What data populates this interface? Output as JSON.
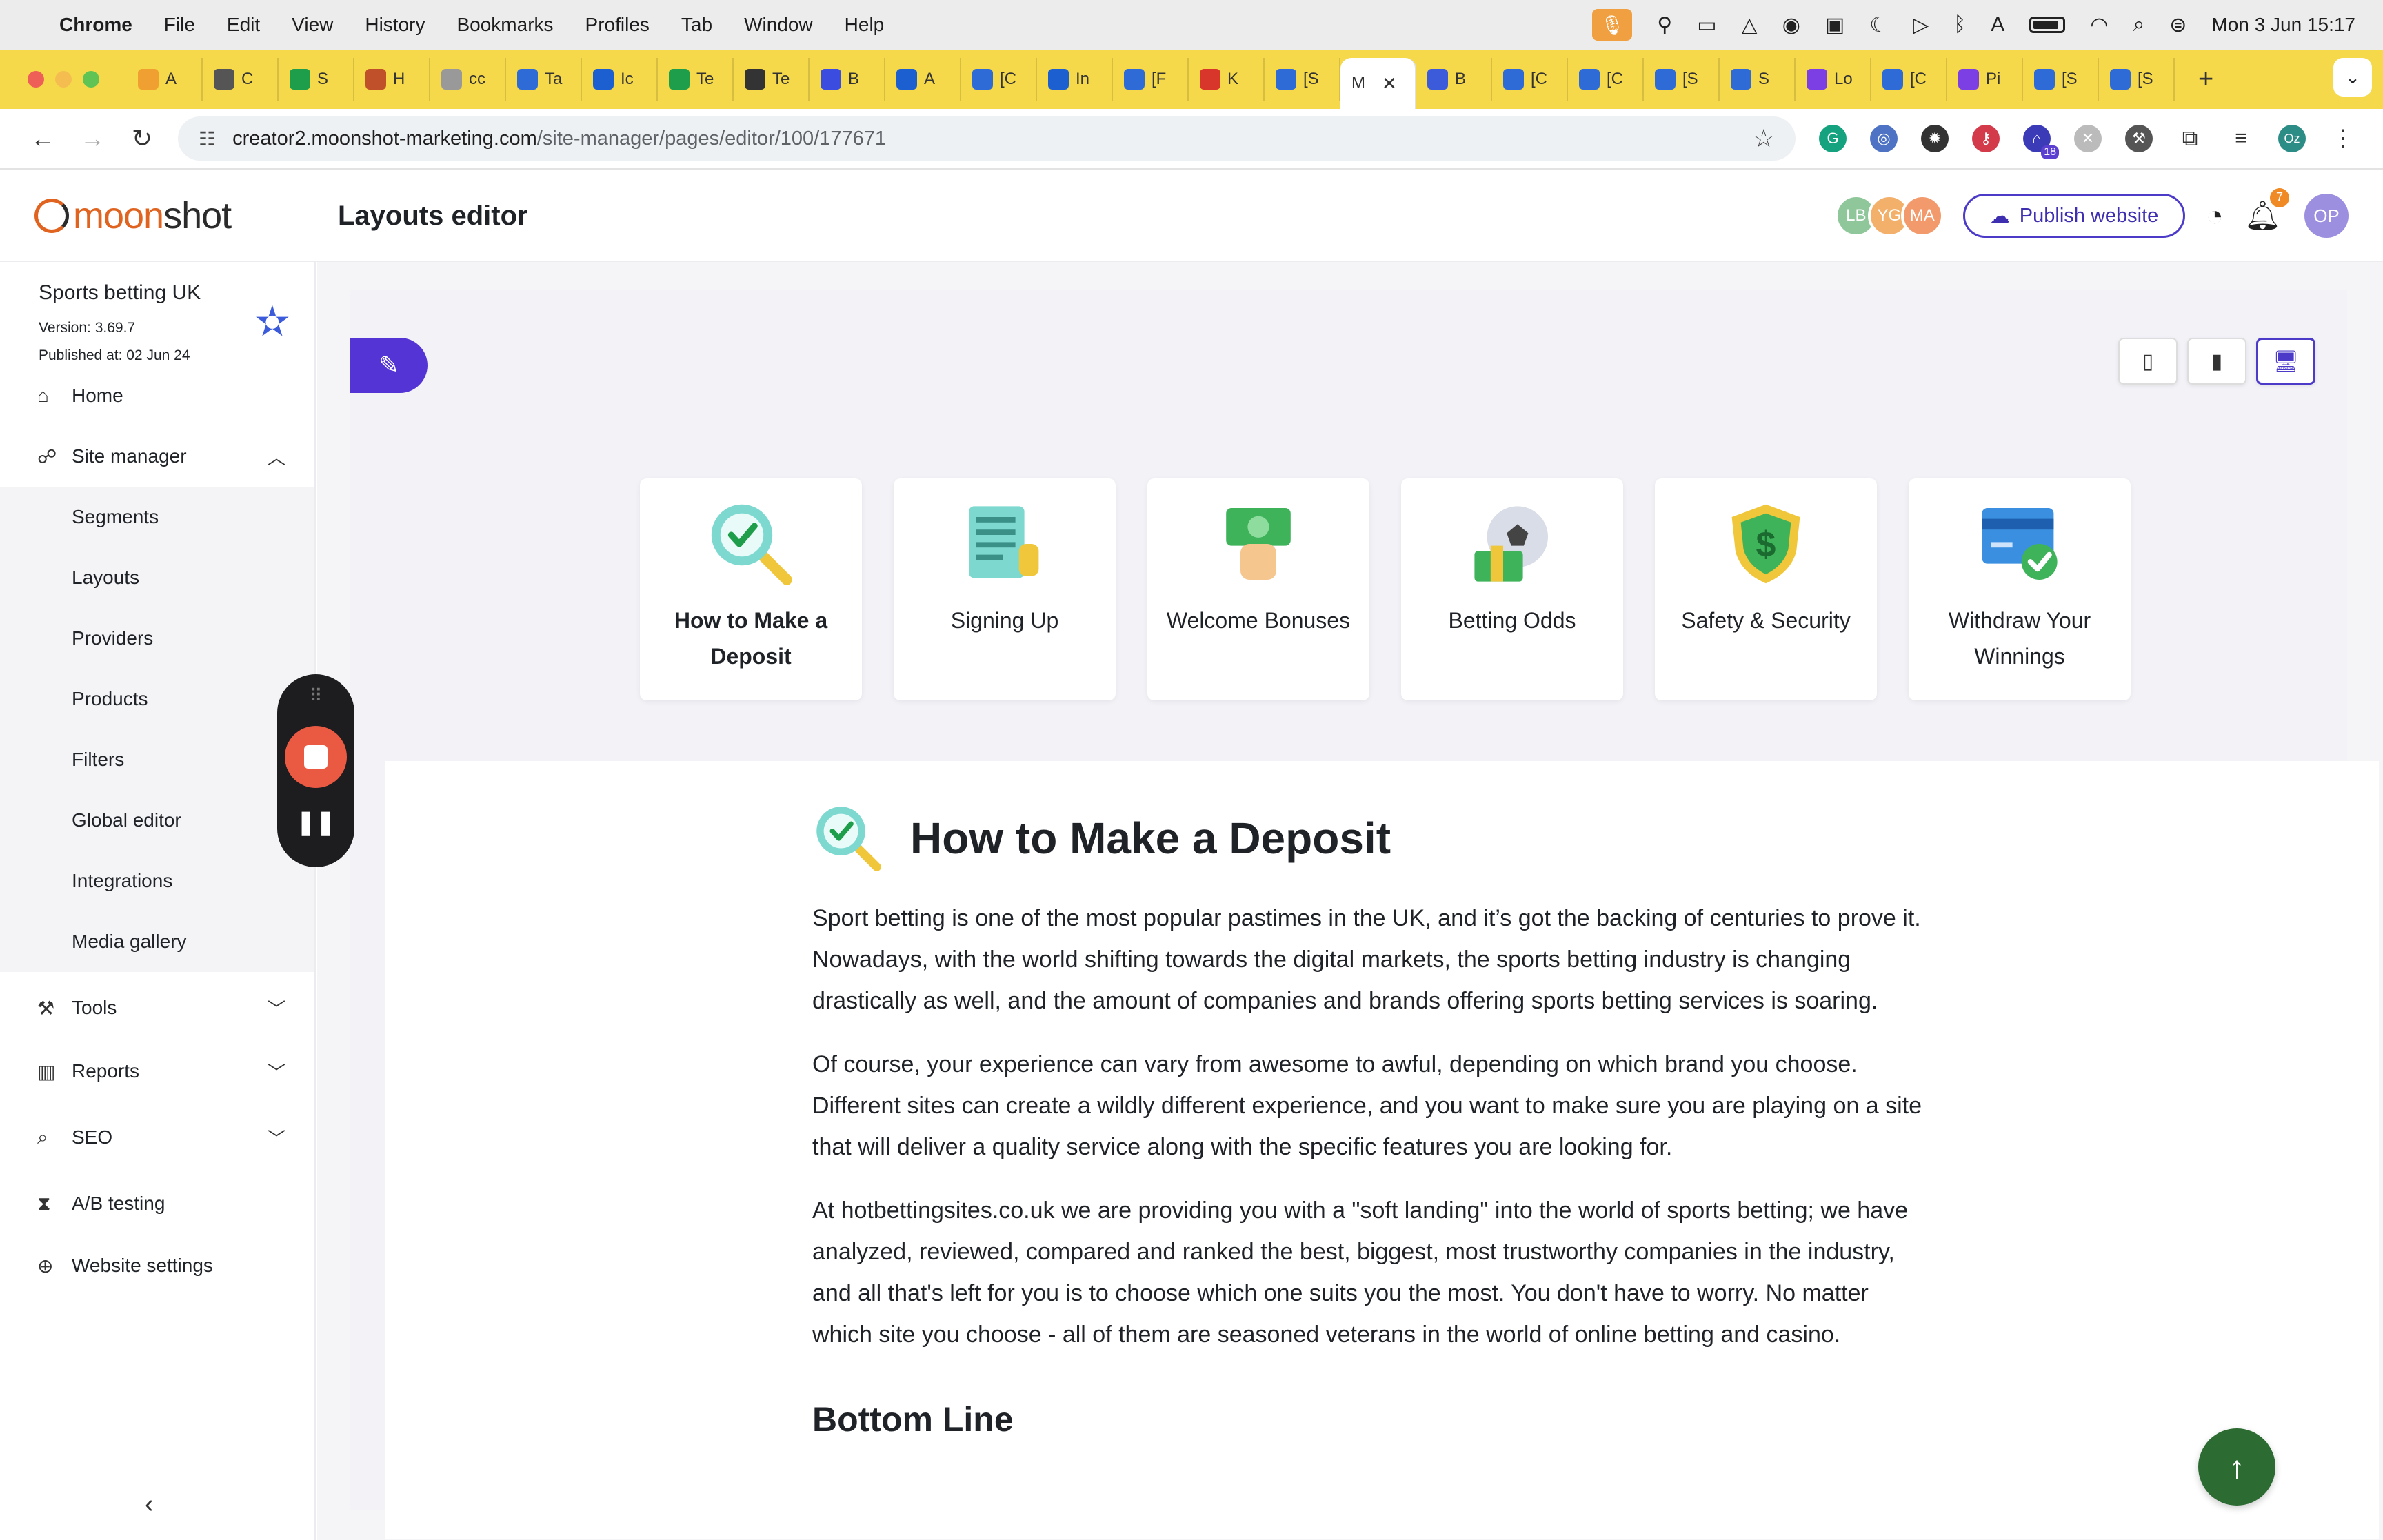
{
  "menubar": {
    "app_name": "Chrome",
    "items": [
      "File",
      "Edit",
      "View",
      "History",
      "Bookmarks",
      "Profiles",
      "Tab",
      "Window",
      "Help"
    ],
    "clock": "Mon 3 Jun  15:17"
  },
  "tabs": [
    {
      "label": "A",
      "color": "#f0a030"
    },
    {
      "label": "C",
      "color": "#555555"
    },
    {
      "label": "S",
      "color": "#1e9e4a"
    },
    {
      "label": "H",
      "color": "#c0502a"
    },
    {
      "label": "cc",
      "color": "#999999"
    },
    {
      "label": "Ta",
      "color": "#2f6bd6"
    },
    {
      "label": "Ic",
      "color": "#1b5fd0"
    },
    {
      "label": "Te",
      "color": "#1e9e4a"
    },
    {
      "label": "Te",
      "color": "#333333"
    },
    {
      "label": "B",
      "color": "#3b4ce0"
    },
    {
      "label": "A",
      "color": "#1b5fd0"
    },
    {
      "label": "[C",
      "color": "#2f6bd6"
    },
    {
      "label": "In",
      "color": "#1b5fd0"
    },
    {
      "label": "[F",
      "color": "#2f6bd6"
    },
    {
      "label": "K",
      "color": "#d9362b"
    },
    {
      "label": "[S",
      "color": "#2f6bd6"
    },
    {
      "label": "M",
      "color": "#ffffff",
      "active": true
    },
    {
      "label": "B",
      "color": "#3b5bdb"
    },
    {
      "label": "[C",
      "color": "#2f6bd6"
    },
    {
      "label": "[C",
      "color": "#2f6bd6"
    },
    {
      "label": "[S",
      "color": "#2f6bd6"
    },
    {
      "label": "S",
      "color": "#2f6bd6"
    },
    {
      "label": "Lo",
      "color": "#7b3fe4"
    },
    {
      "label": "[C",
      "color": "#2f6bd6"
    },
    {
      "label": "Pi",
      "color": "#7b3fe4"
    },
    {
      "label": "[S",
      "color": "#2f6bd6"
    },
    {
      "label": "[S",
      "color": "#2f6bd6"
    }
  ],
  "address": {
    "host": "creator2.moonshot-marketing.com",
    "path": "/site-manager/pages/editor/100/177671"
  },
  "extensions": {
    "badge": "18",
    "profile": "Oz"
  },
  "header": {
    "logo_part1": "moon",
    "logo_part2": "shot",
    "title": "Layouts editor",
    "collaborators": [
      {
        "initials": "LB",
        "color": "#8fc79a"
      },
      {
        "initials": "YG",
        "color": "#f2b06b"
      },
      {
        "initials": "MA",
        "color": "#f29a6b"
      }
    ],
    "publish_label": "Publish website",
    "notification_count": "7",
    "user_initials": "OP"
  },
  "sidebar": {
    "site_name": "Sports betting UK",
    "version": "Version: 3.69.7",
    "published": "Published at: 02 Jun 24",
    "home": "Home",
    "site_manager": "Site manager",
    "sub_items": [
      "Segments",
      "Layouts",
      "Providers",
      "Products",
      "Filters",
      "Global editor",
      "Integrations",
      "Media gallery"
    ],
    "tools": "Tools",
    "reports": "Reports",
    "seo": "SEO",
    "ab_testing": "A/B testing",
    "website_settings": "Website settings"
  },
  "cards": [
    {
      "label": "How to Make a Deposit",
      "icon": "magnifier-check-icon",
      "selected": true
    },
    {
      "label": "Signing Up",
      "icon": "form-pen-icon"
    },
    {
      "label": "Welcome Bonuses",
      "icon": "money-hand-icon"
    },
    {
      "label": "Betting Odds",
      "icon": "ball-cash-icon"
    },
    {
      "label": "Safety & Security",
      "icon": "shield-dollar-icon"
    },
    {
      "label": "Withdraw Your Winnings",
      "icon": "card-check-icon"
    }
  ],
  "article": {
    "title": "How to Make a Deposit",
    "paragraphs": [
      "Sport betting is one of the most popular pastimes in the UK, and it’s got the backing of centuries to prove it. Nowadays, with the world shifting towards the digital markets, the sports betting industry is changing drastically as well, and the amount of companies and brands offering sports betting services is soaring.",
      "Of course, your experience can vary from awesome to awful, depending on which brand you choose. Different sites can create a wildly different experience, and you want to make sure you are playing on a site that will deliver a quality service along with the specific features you are looking for.",
      "At hotbettingsites.co.uk we are providing you with a \"soft landing\" into the world of sports betting; we have analyzed, reviewed, compared and ranked the best, biggest, most trustworthy companies in the industry, and all that's left for you is to choose which one suits you the most. You don't have to worry. No matter which site you choose - all of them are seasoned veterans in the world of online betting and casino."
    ],
    "subheading": "Bottom Line"
  }
}
